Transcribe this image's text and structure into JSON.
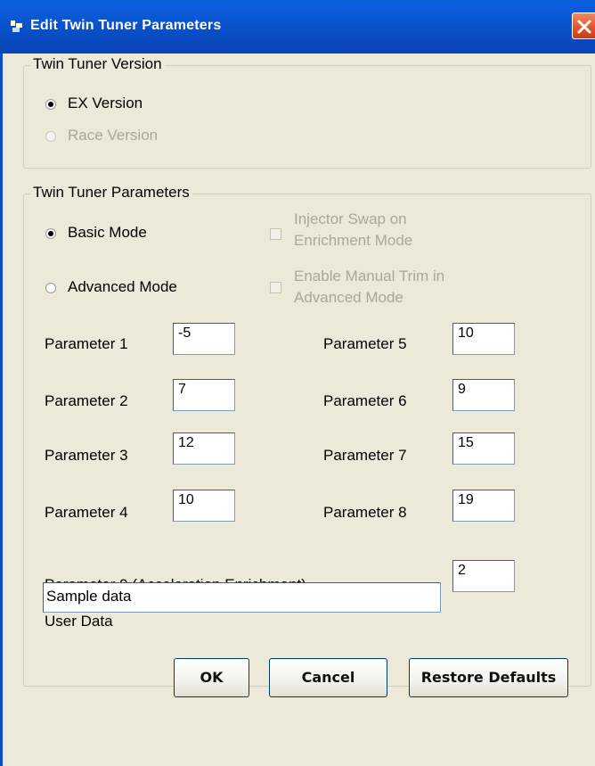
{
  "window": {
    "title": "Edit Twin Tuner Parameters"
  },
  "version_group": {
    "legend": "Twin Tuner  Version",
    "options": [
      {
        "label": "EX Version",
        "checked": true,
        "enabled": true
      },
      {
        "label": "Race Version",
        "checked": false,
        "enabled": false
      }
    ]
  },
  "params_group": {
    "legend": "Twin Tuner  Parameters",
    "modes": [
      {
        "label": "Basic Mode",
        "checked": true
      },
      {
        "label": "Advanced Mode",
        "checked": false
      }
    ],
    "checkboxes": [
      {
        "line1": "Injector Swap on",
        "line2": "Enrichment Mode",
        "enabled": false
      },
      {
        "line1": "Enable Manual Trim in",
        "line2": "Advanced Mode",
        "enabled": false
      }
    ],
    "parameters": [
      {
        "label": "Parameter 1",
        "value": "-5"
      },
      {
        "label": "Parameter 2",
        "value": "7"
      },
      {
        "label": "Parameter 3",
        "value": "12"
      },
      {
        "label": "Parameter 4",
        "value": "10"
      },
      {
        "label": "Parameter 5",
        "value": "10"
      },
      {
        "label": "Parameter 6",
        "value": "9"
      },
      {
        "label": "Parameter 7",
        "value": "15"
      },
      {
        "label": "Parameter 8",
        "value": "19"
      },
      {
        "label": "Parameter 9 (Acceleration Enrichment)",
        "value": "2"
      }
    ],
    "user_data": {
      "label": "User Data",
      "value": "Sample data"
    }
  },
  "buttons": {
    "ok": "OK",
    "cancel": "Cancel",
    "restore": "Restore Defaults"
  },
  "colors": {
    "titlebar": "#0a55d0",
    "dialog_bg": "#ece9d8",
    "close": "#e0522a"
  }
}
